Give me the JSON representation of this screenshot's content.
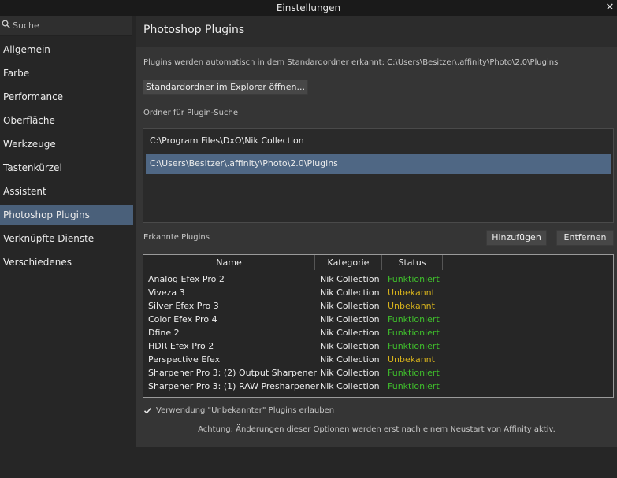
{
  "window": {
    "title": "Einstellungen",
    "close_glyph": "✕"
  },
  "search": {
    "placeholder": "Suche",
    "icon": "search-icon"
  },
  "sidebar": {
    "items": [
      {
        "label": "Allgemein",
        "active": false
      },
      {
        "label": "Farbe",
        "active": false
      },
      {
        "label": "Performance",
        "active": false
      },
      {
        "label": "Oberfläche",
        "active": false
      },
      {
        "label": "Werkzeuge",
        "active": false
      },
      {
        "label": "Tastenkürzel",
        "active": false
      },
      {
        "label": "Assistent",
        "active": false
      },
      {
        "label": "Photoshop Plugins",
        "active": true
      },
      {
        "label": "Verknüpfte Dienste",
        "active": false
      },
      {
        "label": "Verschiedenes",
        "active": false
      }
    ]
  },
  "main": {
    "title": "Photoshop Plugins",
    "info_text": "Plugins werden automatisch in dem Standardordner erkannt: C:\\Users\\Besitzer\\.affinity\\Photo\\2.0\\Plugins",
    "open_folder_button": "Standardordner im Explorer öffnen...",
    "search_folders_label": "Ordner für Plugin-Suche",
    "folders": [
      {
        "path": "C:\\Program Files\\DxO\\Nik Collection",
        "selected": false
      },
      {
        "path": "C:\\Users\\Besitzer\\.affinity\\Photo\\2.0\\Plugins",
        "selected": true
      }
    ],
    "detected_label": "Erkannte Plugins",
    "add_button": "Hinzufügen",
    "remove_button": "Entfernen",
    "table": {
      "columns": [
        "Name",
        "Kategorie",
        "Status"
      ],
      "rows": [
        {
          "name": "Analog Efex Pro 2",
          "category": "Nik Collection",
          "status": "Funktioniert"
        },
        {
          "name": "Viveza 3",
          "category": "Nik Collection",
          "status": "Unbekannt"
        },
        {
          "name": "Silver Efex Pro 3",
          "category": "Nik Collection",
          "status": "Unbekannt"
        },
        {
          "name": "Color Efex Pro 4",
          "category": "Nik Collection",
          "status": "Funktioniert"
        },
        {
          "name": "Dfine 2",
          "category": "Nik Collection",
          "status": "Funktioniert"
        },
        {
          "name": "HDR Efex Pro 2",
          "category": "Nik Collection",
          "status": "Funktioniert"
        },
        {
          "name": "Perspective Efex",
          "category": "Nik Collection",
          "status": "Unbekannt"
        },
        {
          "name": "Sharpener Pro 3: (2) Output Sharpener",
          "category": "Nik Collection",
          "status": "Funktioniert"
        },
        {
          "name": "Sharpener Pro 3: (1) RAW Presharpener",
          "category": "Nik Collection",
          "status": "Funktioniert"
        }
      ]
    },
    "allow_unknown": {
      "label": "Verwendung \"Unbekannter\" Plugins erlauben",
      "checked": true
    },
    "warning": "Achtung: Änderungen dieser Optionen werden erst nach einem Neustart von Affinity aktiv."
  },
  "colors": {
    "ok": "#3fbf2c",
    "unknown": "#d6b21c",
    "accent": "#4f6784"
  }
}
